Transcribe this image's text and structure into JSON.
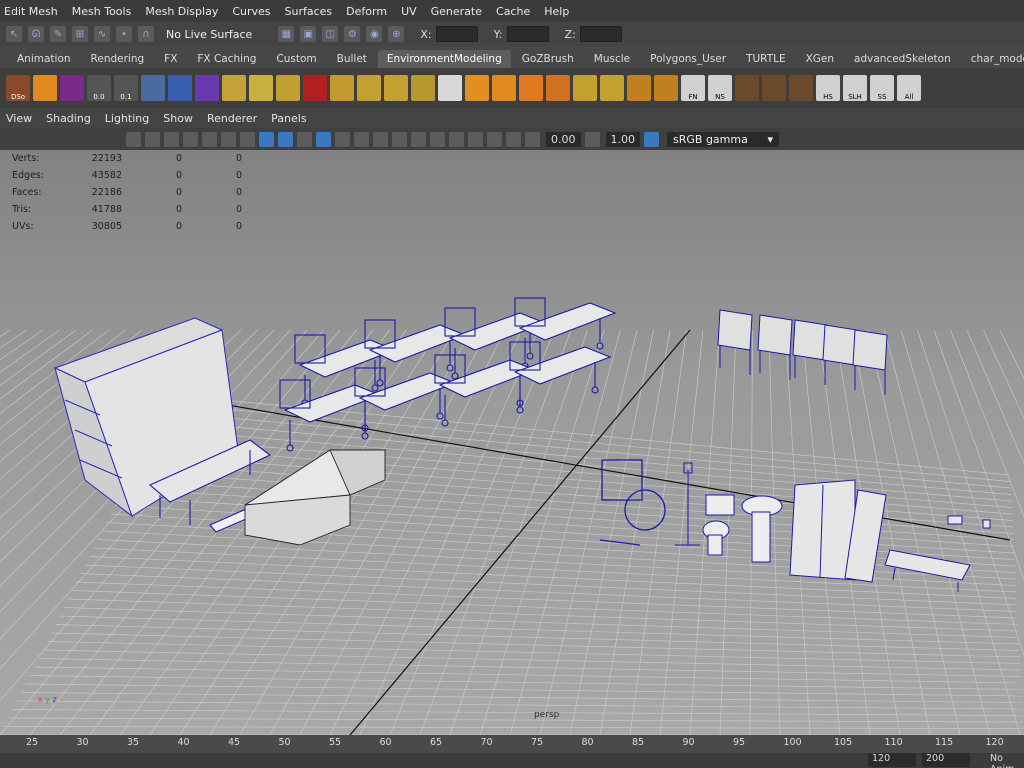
{
  "menu": [
    "Edit Mesh",
    "Mesh Tools",
    "Mesh Display",
    "Curves",
    "Surfaces",
    "Deform",
    "UV",
    "Generate",
    "Cache",
    "Help"
  ],
  "status": {
    "live_surface": "No Live Surface",
    "x_label": "X:",
    "y_label": "Y:",
    "z_label": "Z:"
  },
  "shelf_tabs": [
    "Animation",
    "Rendering",
    "FX",
    "FX Caching",
    "Custom",
    "Bullet",
    "EnvironmentModeling",
    "GoZBrush",
    "Muscle",
    "Polygons_User",
    "TURTLE",
    "XGen",
    "advancedSkeleton",
    "char_model"
  ],
  "active_tab": "EnvironmentModeling",
  "shelf_labels": {
    "dso": "DSo",
    "fn": "FN",
    "ns": "NS",
    "hs": "HS",
    "slh": "SLH",
    "ss": "SS",
    "all": "All",
    "num_a": "0.0",
    "num_b": "0.1"
  },
  "panel_menu": [
    "View",
    "Shading",
    "Lighting",
    "Show",
    "Renderer",
    "Panels"
  ],
  "panel_toolbar": {
    "value1": "0.00",
    "value2": "1.00",
    "color_space": "sRGB gamma"
  },
  "hud": [
    {
      "label": "Verts:",
      "v1": "22193",
      "v2": "0",
      "v3": "0"
    },
    {
      "label": "Edges:",
      "v1": "43582",
      "v2": "0",
      "v3": "0"
    },
    {
      "label": "Faces:",
      "v1": "22186",
      "v2": "0",
      "v3": "0"
    },
    {
      "label": "Tris:",
      "v1": "41788",
      "v2": "0",
      "v3": "0"
    },
    {
      "label": "UVs:",
      "v1": "30805",
      "v2": "0",
      "v3": "0"
    }
  ],
  "camera": "persp",
  "timeline_ticks": [
    "25",
    "30",
    "35",
    "40",
    "45",
    "50",
    "55",
    "60",
    "65",
    "70",
    "75",
    "80",
    "85",
    "90",
    "95",
    "100",
    "105",
    "110",
    "115",
    "120"
  ],
  "range": {
    "end": "120",
    "max": "200",
    "anim_layer": "No Anim"
  },
  "colors": {
    "wire": "#1a1aa8",
    "grid": "#c8c8c8",
    "axis": "#111111"
  }
}
